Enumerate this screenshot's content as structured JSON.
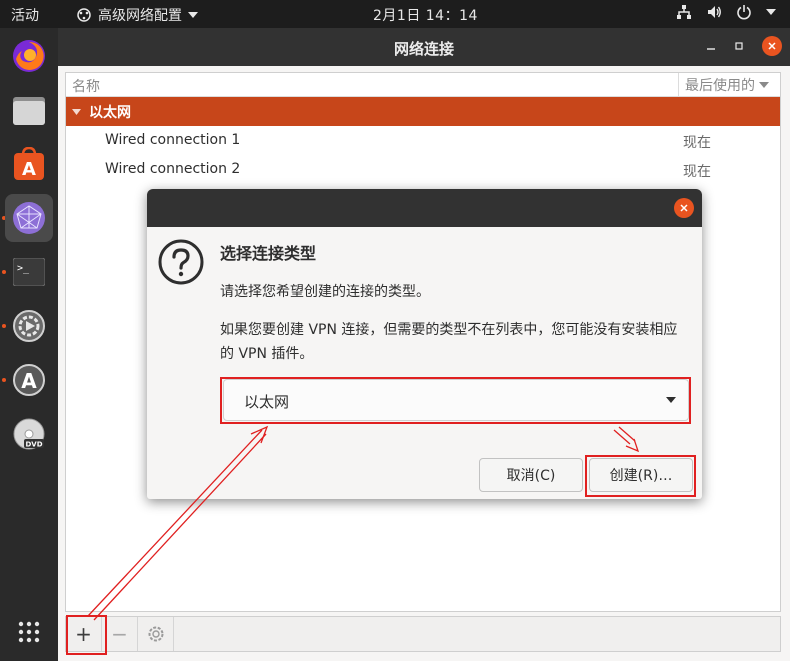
{
  "topbar": {
    "activities": "活动",
    "app_menu": "高级网络配置",
    "clock": "2月1日  14：14"
  },
  "window": {
    "title": "网络连接",
    "columns": {
      "name": "名称",
      "last_used": "最后使用的"
    },
    "group": "以太网",
    "connections": [
      {
        "name": "Wired connection 1",
        "last_used": "现在"
      },
      {
        "name": "Wired connection 2",
        "last_used": "现在"
      }
    ],
    "toolbar": {
      "add": "+",
      "remove": "−"
    }
  },
  "dialog": {
    "title": "选择连接类型",
    "message1": "请选择您希望创建的连接的类型。",
    "message2": "如果您要创建 VPN 连接，但需要的类型不在列表中，您可能没有安装相应的 VPN 插件。",
    "selected_type": "以太网",
    "cancel_label": "取消(C)",
    "create_label": "创建(R)…"
  },
  "colors": {
    "accent": "#e95420",
    "selected_row": "#c7461a",
    "annotation": "#e02020"
  }
}
